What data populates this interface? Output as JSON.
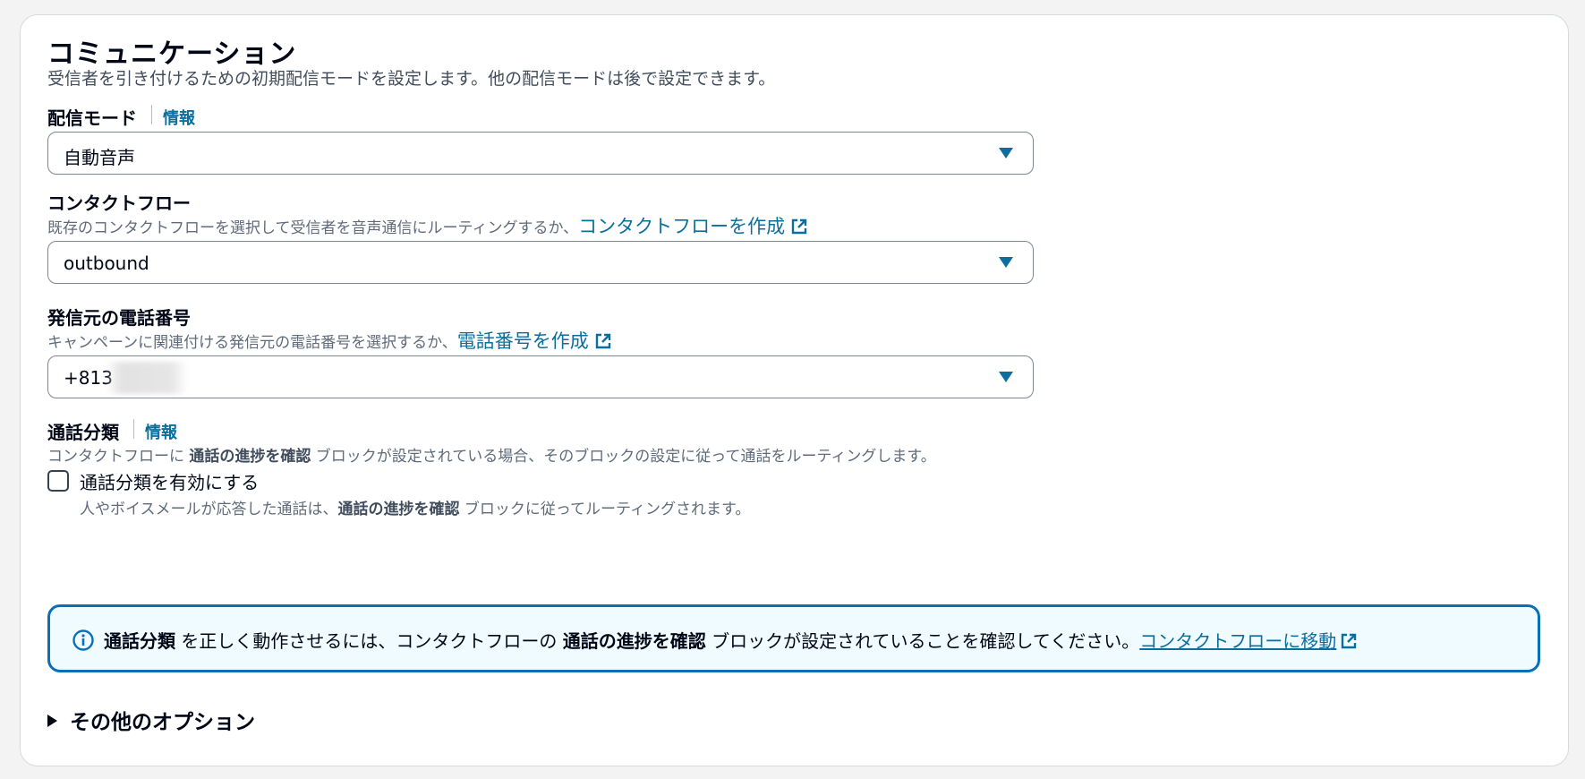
{
  "section": {
    "title": "コミュニケーション",
    "description": "受信者を引き付けるための初期配信モードを設定します。他の配信モードは後で設定できます。"
  },
  "delivery_mode": {
    "label": "配信モード",
    "info": "情報",
    "value": "自動音声"
  },
  "contact_flow": {
    "label": "コンタクトフロー",
    "hint": "既存のコンタクトフローを選択して受信者を音声通信にルーティングするか、",
    "create_link": "コンタクトフローを作成",
    "value": "outbound"
  },
  "phone_number": {
    "label": "発信元の電話番号",
    "hint": "キャンペーンに関連付ける発信元の電話番号を選択するか、",
    "create_link": "電話番号を作成",
    "value": "+813"
  },
  "call_classification": {
    "label": "通話分類",
    "info": "情報",
    "hint_prefix": "コンタクトフローに ",
    "hint_bold": "通話の進捗を確認",
    "hint_suffix": " ブロックが設定されている場合、そのブロックの設定に従って通話をルーティングします。",
    "checkbox_label": "通話分類を有効にする",
    "checkbox_checked": false,
    "checkbox_desc_prefix": "人やボイスメールが応答した通話は、",
    "checkbox_desc_bold": "通話の進捗を確認",
    "checkbox_desc_suffix": " ブロックに従ってルーティングされます。"
  },
  "alert": {
    "bold1": "通話分類",
    "text1": " を正しく動作させるには、コンタクトフローの ",
    "bold2": "通話の進捗を確認",
    "text2": " ブロックが設定されていることを確認してください。",
    "link": "コンタクトフローに移動"
  },
  "more_options": {
    "label": "その他のオプション"
  },
  "colors": {
    "link": "#0b6f9e",
    "alert_border": "#0b6fb8",
    "alert_bg": "#f0fbff"
  }
}
